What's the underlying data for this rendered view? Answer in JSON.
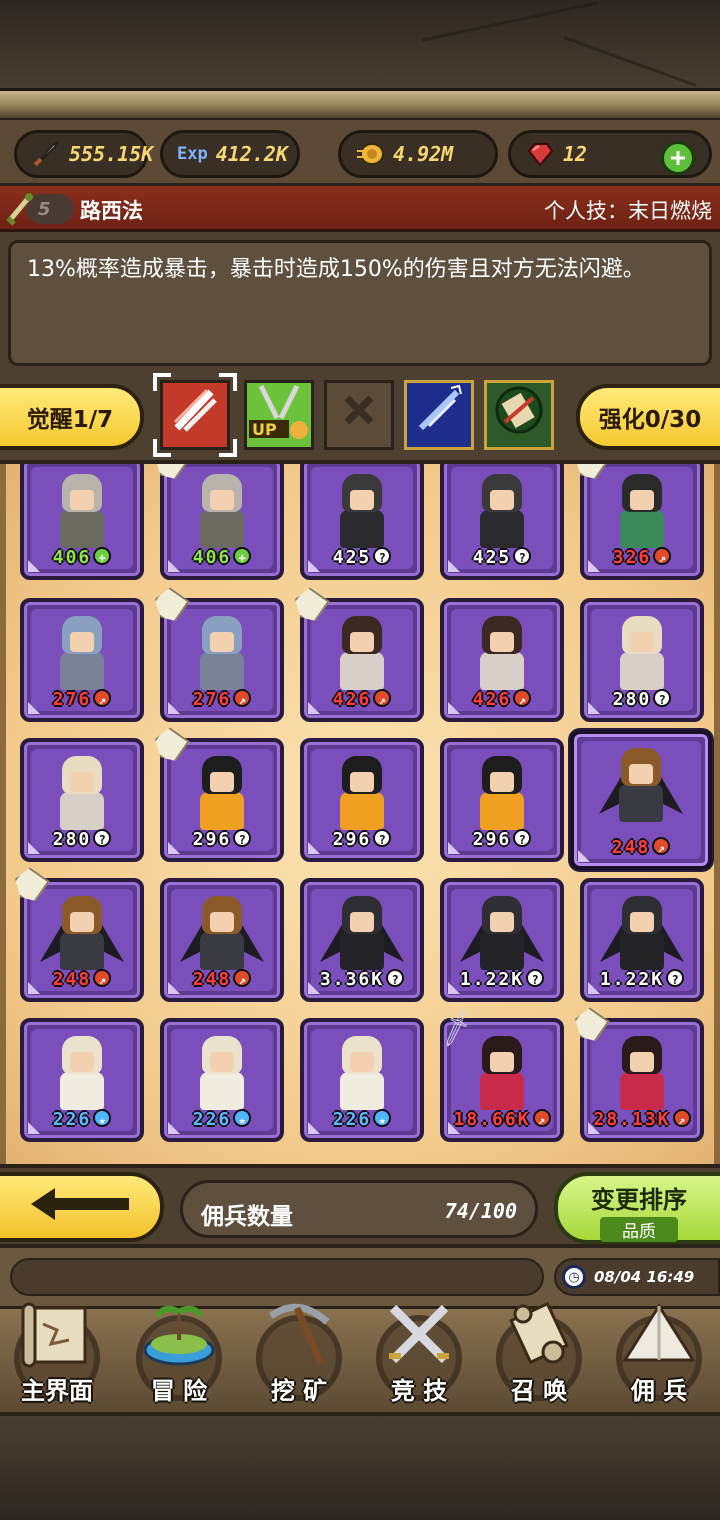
{
  "resources": {
    "attack": "555.15K",
    "exp_label": "Exp",
    "exp": "412.2K",
    "gold": "4.92M",
    "gems": "12"
  },
  "hero": {
    "stars": "5",
    "name": "路西法",
    "skill": "个人技：末日燃烧"
  },
  "description": "13%概率造成暴击，暴击时造成150%的伤害且对方无法闪避。",
  "tabs": {
    "awaken": "觉醒1/7",
    "enhance": "强化0/30",
    "up_label": "UP"
  },
  "units": [
    {
      "level": "406",
      "badge": "+",
      "style": "green",
      "skin": "gray"
    },
    {
      "level": "406",
      "badge": "+",
      "style": "green",
      "skin": "gray",
      "tag": true
    },
    {
      "level": "425",
      "badge": "?",
      "style": "white",
      "skin": "dark"
    },
    {
      "level": "425",
      "badge": "?",
      "style": "white",
      "skin": "dark"
    },
    {
      "level": "326",
      "badge": "↗",
      "style": "red",
      "skin": "green",
      "tag": true
    },
    {
      "level": "276",
      "badge": "↗",
      "style": "red",
      "skin": "steel"
    },
    {
      "level": "276",
      "badge": "↗",
      "style": "red",
      "skin": "steel",
      "tag": true
    },
    {
      "level": "426",
      "badge": "↗",
      "style": "red",
      "skin": "maid",
      "tag": true
    },
    {
      "level": "426",
      "badge": "↗",
      "style": "red",
      "skin": "maid"
    },
    {
      "level": "280",
      "badge": "?",
      "style": "white",
      "skin": "blonde"
    },
    {
      "level": "280",
      "badge": "?",
      "style": "white",
      "skin": "blonde"
    },
    {
      "level": "296",
      "badge": "?",
      "style": "white",
      "skin": "orange",
      "tag": true
    },
    {
      "level": "296",
      "badge": "?",
      "style": "white",
      "skin": "orange"
    },
    {
      "level": "296",
      "badge": "?",
      "style": "white",
      "skin": "orange"
    },
    {
      "level": "248",
      "badge": "↗",
      "style": "red",
      "skin": "winged",
      "big": true
    },
    {
      "level": "248",
      "badge": "↗",
      "style": "red",
      "skin": "winged",
      "tag": true
    },
    {
      "level": "248",
      "badge": "↗",
      "style": "red",
      "skin": "winged"
    },
    {
      "level": "3.36K",
      "badge": "?",
      "style": "white",
      "skin": "shadow"
    },
    {
      "level": "1.22K",
      "badge": "?",
      "style": "white",
      "skin": "shadow"
    },
    {
      "level": "1.22K",
      "badge": "?",
      "style": "white",
      "skin": "shadow"
    },
    {
      "level": "226",
      "badge": "★",
      "style": "blue",
      "skin": "cream"
    },
    {
      "level": "226",
      "badge": "★",
      "style": "blue",
      "skin": "cream"
    },
    {
      "level": "226",
      "badge": "★",
      "style": "blue",
      "skin": "cream"
    },
    {
      "level": "18.66K",
      "badge": "↗",
      "style": "red",
      "skin": "flower",
      "sword": true
    },
    {
      "level": "28.13K",
      "badge": "↗",
      "style": "red",
      "skin": "flower",
      "tag": true
    }
  ],
  "footer_bar": {
    "count_label": "佣兵数量",
    "count_value": "74/100",
    "sort_title": "变更排序",
    "sort_sub": "品质"
  },
  "clock": "08/04 16:49",
  "nav": [
    {
      "label": "主界面",
      "icon": "map-scroll-icon"
    },
    {
      "label": "冒 险",
      "icon": "island-icon"
    },
    {
      "label": "挖 矿",
      "icon": "pickaxe-icon"
    },
    {
      "label": "竞 技",
      "icon": "crossed-swords-icon"
    },
    {
      "label": "召 唤",
      "icon": "summon-scroll-icon"
    },
    {
      "label": "佣 兵",
      "icon": "tent-icon"
    }
  ]
}
